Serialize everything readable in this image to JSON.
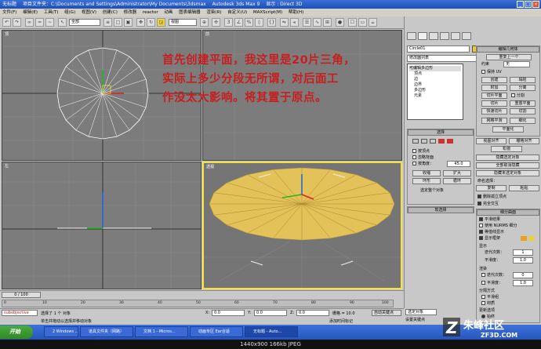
{
  "window": {
    "icon_label": "无标题",
    "project_label": "项目文件夹：C:\\Documents and Settings\\Administrator\\My Documents\\3dsmax",
    "app_title": "Autodesk 3ds Max 9",
    "display_label": "显示 : Direct 3D"
  },
  "menubar": [
    "文件(F)",
    "编辑(E)",
    "工具(T)",
    "组(G)",
    "视图(V)",
    "创建(C)",
    "修改器",
    "reactor",
    "动画",
    "图表编辑器",
    "渲染(R)",
    "自定义(U)",
    "MAXScript(M)",
    "帮助(H)"
  ],
  "toolbar": {
    "selection_filter": "全部",
    "coord_system": "视图"
  },
  "viewports": {
    "top": "顶",
    "front": "前",
    "left": "左",
    "persp": "透视"
  },
  "annotation": {
    "line1": "首先创建平面，我这里是20片三角，",
    "line2": "实际上多少分段无所谓，对后面工",
    "line3": "作没太大影响。将其置于原点。"
  },
  "command_panel": {
    "object_name": "Circle01",
    "modifier_list": "修改器列表",
    "stack": {
      "root": "可编辑多边形",
      "items": [
        "顶点",
        "边",
        "边界",
        "多边形",
        "元素"
      ]
    },
    "edit_geometry_title": "编辑几何体",
    "repeat_last": "重复上一个",
    "constraints_label": "约束",
    "constraints_value": "无",
    "preserve_uv": "保持 UV",
    "create": "创建",
    "collapse": "塌陷",
    "attach": "附加",
    "detach": "分离",
    "slice_plane": "切片平面",
    "split": "分割",
    "slice": "切片",
    "reset_plane": "重置平面",
    "quickslice": "快速切片",
    "cut": "切割",
    "msmooth": "网格平滑",
    "tessellate": "细化",
    "make_planar": "平面化",
    "view_align": "视图对齐",
    "grid_align": "栅格对齐",
    "relax": "松弛",
    "hide_selected": "隐藏选定对象",
    "unhide_all": "全部取消隐藏",
    "hide_unselected": "隐藏未选定对象",
    "named_selections": "命名选择：",
    "copy": "复制",
    "paste": "粘贴",
    "delete_isolated": "删除孤立顶点",
    "full_interactivity": "完全交互",
    "selection_title": "选择",
    "by_vertex": "按顶点",
    "ignore_backfacing": "忽略背面",
    "by_angle": "按角度：",
    "angle_value": "45.0",
    "shrink": "收缩",
    "grow": "扩大",
    "ring": "环形",
    "loop": "循环",
    "whole_object_selected": "选定整个对象",
    "soft_selection_title": "软选择",
    "subdivision_title": "细分曲面",
    "smooth_result": "平滑结果",
    "use_nurms": "使用 NURMS 细分",
    "isoline_display": "等值线显示",
    "show_cage": "显示框架",
    "display_label": "显示",
    "iterations_label": "迭代次数：",
    "iterations_value": "1",
    "smoothness_label": "平滑度：",
    "smoothness_value": "1.0",
    "render_label": "渲染",
    "render_iterations_value": "0",
    "render_smoothness_value": "1.0",
    "separate_by": "分隔方式",
    "smoothing_groups": "平滑组",
    "materials": "材质",
    "update_options": "更新选项",
    "always": "始终",
    "when_rendering": "渲染时",
    "manually": "手动"
  },
  "timeline": {
    "frame_slider": "0 / 100",
    "ticks": [
      "0",
      "10",
      "20",
      "30",
      "40",
      "50",
      "60",
      "70",
      "80",
      "90",
      "100"
    ]
  },
  "status": {
    "script_field": "subobjective",
    "selected_text": "选择了 1 个 对象",
    "prompt_text": "单击并拖动以选择并移动对象",
    "x_label": "X:",
    "x_value": "0.0",
    "y_label": "Y:",
    "y_value": "0.0",
    "z_label": "Z:",
    "z_value": "0.0",
    "grid_label": "栅格 = 10.0",
    "add_time_tag": "添加时间标记",
    "auto_key": "自动关键点",
    "selected_dropdown": "选定对象",
    "set_key": "设置关键点",
    "key_filters": "关键点过滤器..."
  },
  "taskbar": {
    "start": "开始",
    "tasks": [
      "2 Windows ...",
      "道具文件夹（网路）",
      "文档 1 - Micros...",
      "动画专区 Ear合适",
      "无标题 - Auto..."
    ]
  },
  "caption": "1440x900  166kb  JPEG",
  "watermark": {
    "name": "朱峰社区",
    "domain": "ZF3D.COM"
  },
  "colors": {
    "accent": "#f4e23b",
    "annotation": "#c81e1e",
    "plane_fill": "#e3c25a",
    "viewport_bg": "#7c7c7c"
  }
}
